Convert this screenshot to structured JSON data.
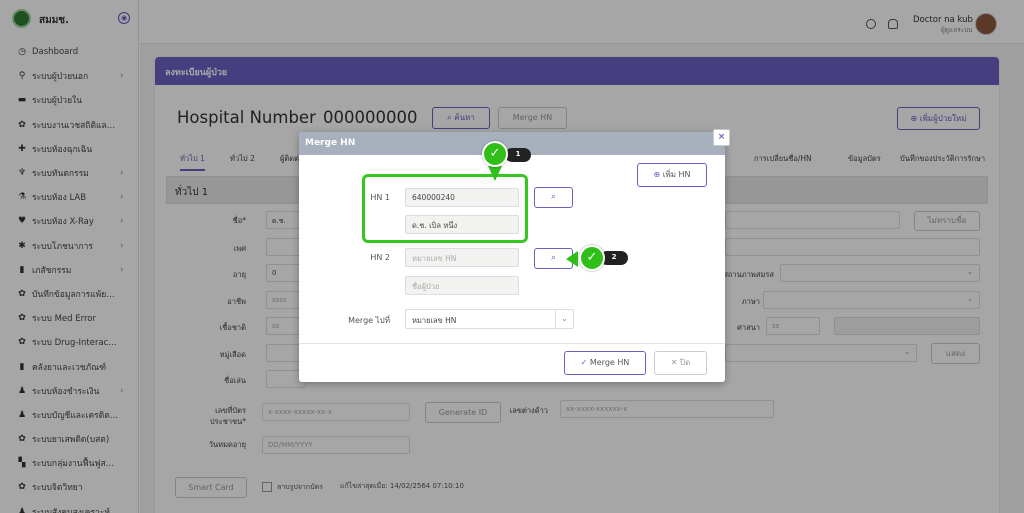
{
  "sidebar": {
    "brand": "สมมช.",
    "items": [
      {
        "icon": "clock-icon",
        "label": "Dashboard",
        "chevron": false
      },
      {
        "icon": "walk-icon",
        "label": "ระบบผู้ป่วยนอก",
        "chevron": true
      },
      {
        "icon": "bed-icon",
        "label": "ระบบผู้ป่วยใน",
        "chevron": false
      },
      {
        "icon": "hands-icon",
        "label": "ระบบงานเวชสถิติและ...",
        "chevron": false
      },
      {
        "icon": "plus-icon",
        "label": "ระบบห้องฉุกเฉิน",
        "chevron": false
      },
      {
        "icon": "tooth-icon",
        "label": "ระบบทันตกรรม",
        "chevron": true
      },
      {
        "icon": "flask-icon",
        "label": "ระบบห้อง LAB",
        "chevron": true
      },
      {
        "icon": "heart-icon",
        "label": "ระบบห้อง X-Ray",
        "chevron": true
      },
      {
        "icon": "nutrition-icon",
        "label": "ระบบโภชนาการ",
        "chevron": true
      },
      {
        "icon": "pill-icon",
        "label": "เภสัชกรรม",
        "chevron": true
      },
      {
        "icon": "record-icon",
        "label": "บันทึกข้อมูลการแพ้ยา...",
        "chevron": false
      },
      {
        "icon": "error-icon",
        "label": "ระบบ Med Error",
        "chevron": false
      },
      {
        "icon": "interaction-icon",
        "label": "ระบบ Drug-Interac...",
        "chevron": false
      },
      {
        "icon": "warehouse-icon",
        "label": "คลังยาและเวชภัณฑ์",
        "chevron": false
      },
      {
        "icon": "cashier-icon",
        "label": "ระบบห้องชำระเงิน",
        "chevron": true
      },
      {
        "icon": "account-icon",
        "label": "ระบบบัญชีและเครดิต...",
        "chevron": false
      },
      {
        "icon": "drug-icon",
        "label": "ระบบยาเสพติด(บสต)",
        "chevron": false
      },
      {
        "icon": "rehab-icon",
        "label": "ระบบกลุ่มงานฟื้นฟูสม...",
        "chevron": false
      },
      {
        "icon": "psych-icon",
        "label": "ระบบจิตวิทยา",
        "chevron": false
      },
      {
        "icon": "social-icon",
        "label": "ระบบสังคมสงเคราะห์",
        "chevron": false
      }
    ]
  },
  "topbar": {
    "user_name": "Doctor na kub",
    "user_role": "ผู้ดูแลระบบ"
  },
  "page": {
    "header": "ลงทะเบียนผู้ป่วย",
    "hn_label": "Hospital Number",
    "hn_value": "000000000",
    "search_btn": "ค้นหา",
    "merge_btn": "Merge HN",
    "add_patient_btn": "เพิ่มผู้ป่วยใหม่",
    "tabs": [
      "ทั่วไป 1",
      "ทั่วไป 2",
      "ผู้ติดต่อ",
      "การเปลี่ยนชื่อ/HN",
      "ข้อมูลบัตร",
      "บันทึกของประวัติการรักษา"
    ],
    "section_title": "ทั่วไป 1",
    "labels": {
      "name": "ชื่อ*",
      "sex": "เพศ",
      "age": "อายุ",
      "occupation": "อาชีพ",
      "nationality": "เชื้อชาติ",
      "blood": "หมู่เลือด",
      "nickname": "ชื่อเล่น",
      "id_card": "เลขที่บัตรประชาชน*",
      "expiry": "วันหมดอายุ",
      "alien_id": "เลขต่างด้าว",
      "marital": "สถานภาพสมรส",
      "language": "ภาษา",
      "religion": "ศาสนา"
    },
    "values": {
      "prefix": "ด.ช.",
      "age": "0",
      "occupation": "ssss",
      "nationality": "ss",
      "id_card_placeholder": "x-xxxx-xxxxx-xx-x",
      "alien_placeholder": "xx-xxxx-xxxxxx-x",
      "expiry_placeholder": "DD/MM/YYYY",
      "religion": "ss"
    },
    "buttons": {
      "change_name": "ไม่ทราบชื่อ",
      "generate_id": "Generate ID",
      "add": "แสดง",
      "smart_card": "Smart Card"
    },
    "checkbox_label": "ลาบรูปจากบัตร",
    "last_update": "แก้ไขล่าสุดเมื่อ: 14/02/2564 07:10:10"
  },
  "modal": {
    "title": "Merge HN",
    "close": "×",
    "add_hn_btn": "เพิ่ม HN",
    "hn1_label": "HN 1",
    "hn1_value": "640000240",
    "hn1_name": "ด.ช. เบิล หนึ่ง",
    "hn2_label": "HN 2",
    "hn2_placeholder": "หมายเลข HN",
    "hn2_name_placeholder": "ชื่อผู้ป่วย",
    "merge_to_label": "Merge ไปที่",
    "merge_to_value": "หมายเลข HN",
    "merge_btn": "Merge HN",
    "cancel_btn": "ปิด"
  },
  "annotations": {
    "step1": "1",
    "step2": "2",
    "highlight_color": "#34c81f"
  }
}
